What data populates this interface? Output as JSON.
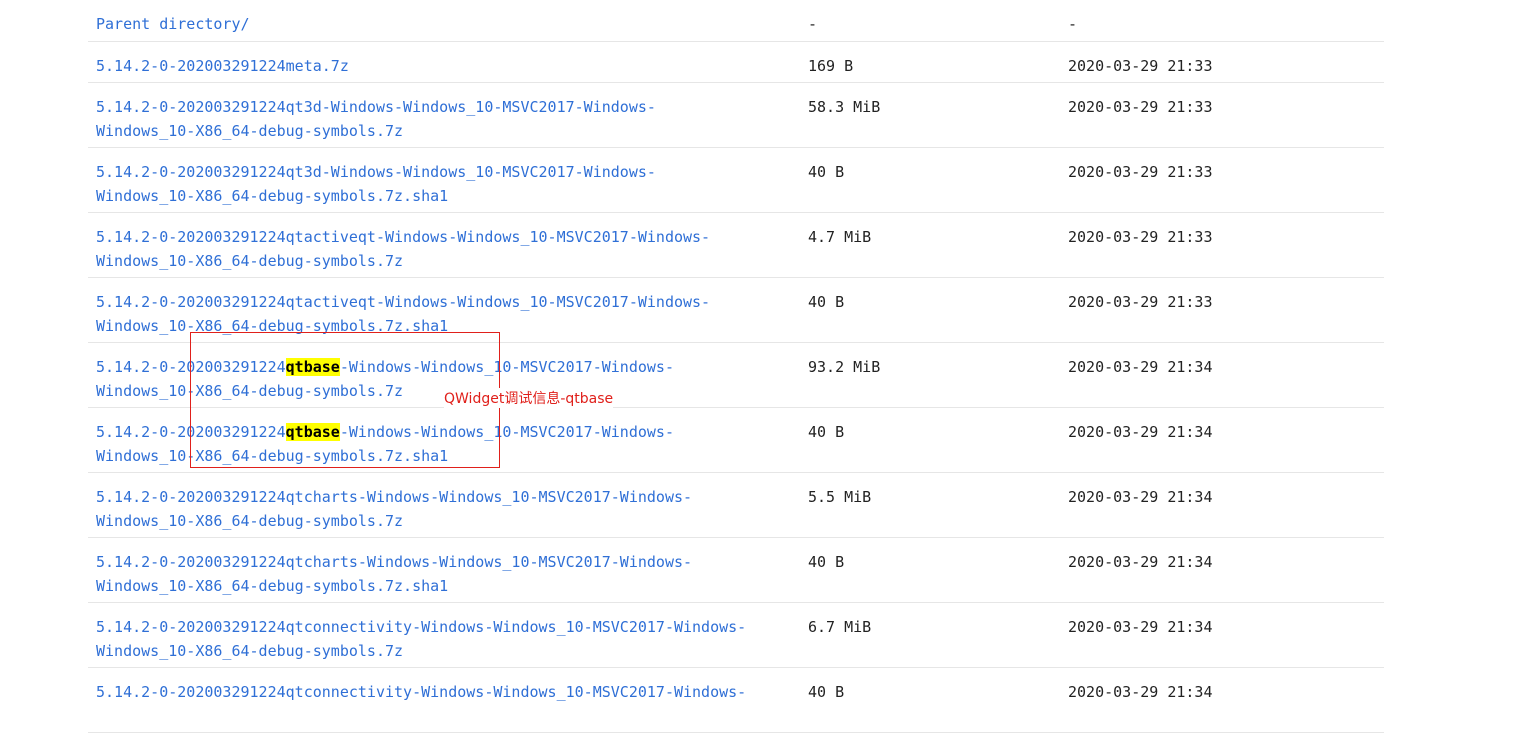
{
  "rows": [
    {
      "name": "Parent directory/",
      "size": "-",
      "date": "-"
    },
    {
      "name": "5.14.2-0-202003291224meta.7z",
      "size": "169 B",
      "date": "2020-03-29 21:33"
    },
    {
      "name_a": "5.14.2-0-202003291224qt3d-Windows-Windows_10-MSVC2017-Windows-",
      "name_b": "Windows_10-X86_64-debug-symbols.7z",
      "size": "58.3 MiB",
      "date": "2020-03-29 21:33"
    },
    {
      "name_a": "5.14.2-0-202003291224qt3d-Windows-Windows_10-MSVC2017-Windows-",
      "name_b": "Windows_10-X86_64-debug-symbols.7z.sha1",
      "size": "40 B",
      "date": "2020-03-29 21:33"
    },
    {
      "name_a": "5.14.2-0-202003291224qtactiveqt-Windows-Windows_10-MSVC2017-Windows-",
      "name_b": "Windows_10-X86_64-debug-symbols.7z",
      "size": "4.7 MiB",
      "date": "2020-03-29 21:33"
    },
    {
      "name_a": "5.14.2-0-202003291224qtactiveqt-Windows-Windows_10-MSVC2017-Windows-",
      "name_b": "Windows_10-X86_64-debug-symbols.7z.sha1",
      "size": "40 B",
      "date": "2020-03-29 21:33"
    },
    {
      "prefix": "5.14.2-0-202003291224",
      "highlight": "qtbase",
      "suffix": "-Windows-Windows_10-MSVC2017-Windows-",
      "name_b": "Windows_10-X86_64-debug-symbols.7z",
      "size": "93.2 MiB",
      "date": "2020-03-29 21:34"
    },
    {
      "prefix": "5.14.2-0-202003291224",
      "highlight": "qtbase",
      "suffix": "-Windows-Windows_10-MSVC2017-Windows-",
      "name_b": "Windows_10-X86_64-debug-symbols.7z.sha1",
      "size": "40 B",
      "date": "2020-03-29 21:34"
    },
    {
      "name_a": "5.14.2-0-202003291224qtcharts-Windows-Windows_10-MSVC2017-Windows-",
      "name_b": "Windows_10-X86_64-debug-symbols.7z",
      "size": "5.5 MiB",
      "date": "2020-03-29 21:34"
    },
    {
      "name_a": "5.14.2-0-202003291224qtcharts-Windows-Windows_10-MSVC2017-Windows-",
      "name_b": "Windows_10-X86_64-debug-symbols.7z.sha1",
      "size": "40 B",
      "date": "2020-03-29 21:34"
    },
    {
      "name_a": "5.14.2-0-202003291224qtconnectivity-Windows-Windows_10-MSVC2017-Windows-",
      "name_b": "Windows_10-X86_64-debug-symbols.7z",
      "size": "6.7 MiB",
      "date": "2020-03-29 21:34"
    },
    {
      "name_a": "5.14.2-0-202003291224qtconnectivity-Windows-Windows_10-MSVC2017-Windows-",
      "size": "40 B",
      "date": "2020-03-29 21:34"
    }
  ],
  "annotation": {
    "label": "QWidget调试信息-qtbase",
    "color": "#e0201b"
  },
  "colors": {
    "link": "#2f6fd6",
    "highlight": "#ffff00",
    "divider": "#e6e6e6"
  }
}
